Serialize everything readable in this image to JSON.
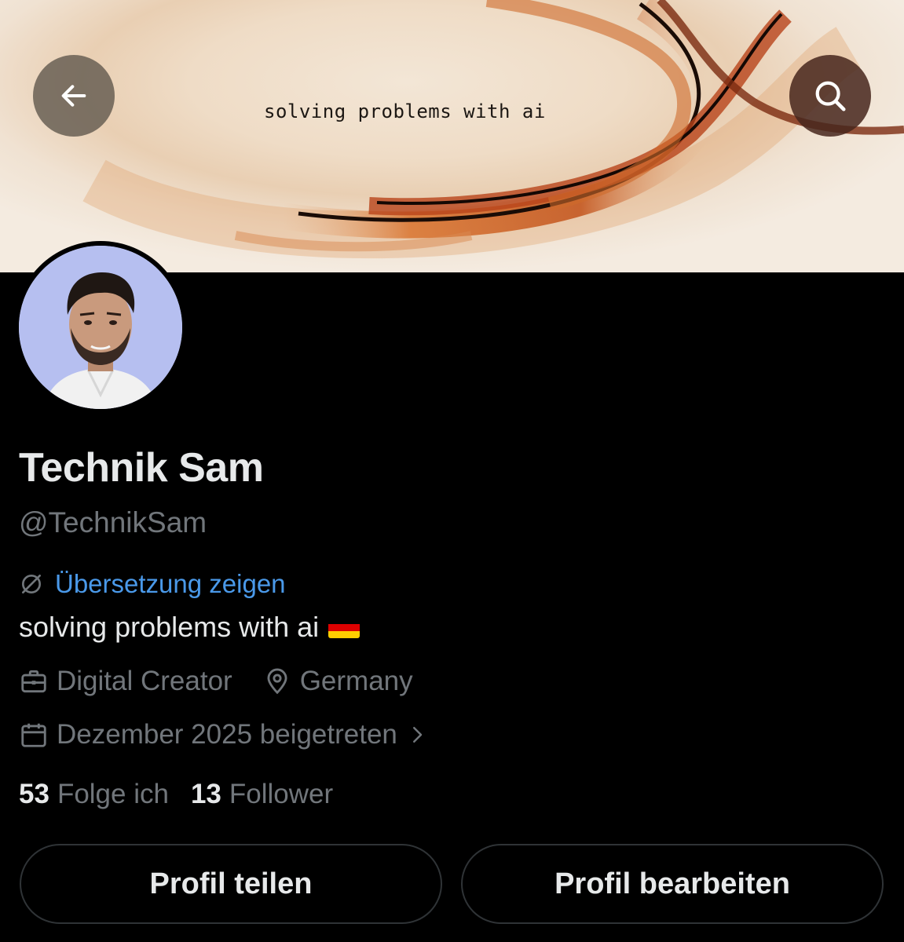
{
  "banner": {
    "text": "solving problems with ai"
  },
  "header": {
    "back_icon": "arrow-left-icon",
    "search_icon": "search-icon"
  },
  "profile": {
    "name": "Technik Sam",
    "handle": "@TechnikSam",
    "translate_label": "Übersetzung zeigen",
    "bio": "solving problems with ai",
    "bio_flag": "germany-flag-emoji",
    "category": "Digital Creator",
    "location": "Germany",
    "joined": "Dezember 2025 beigetreten"
  },
  "stats": {
    "following_count": "53",
    "following_label": "Folge ich",
    "followers_count": "13",
    "followers_label": "Follower"
  },
  "actions": {
    "share_label": "Profil teilen",
    "edit_label": "Profil bearbeiten"
  },
  "colors": {
    "background": "#000000",
    "text_primary": "#e7e9ea",
    "text_secondary": "#71767b",
    "link": "#4a99e9",
    "button_border": "#2f3336"
  }
}
